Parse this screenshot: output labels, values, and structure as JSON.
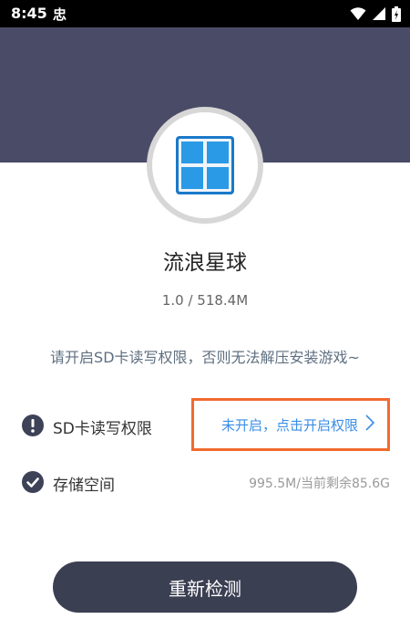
{
  "status_bar": {
    "time": "8:45",
    "notification": "忠"
  },
  "app": {
    "name": "流浪星球",
    "version_size": "1.0 / 518.4M",
    "icon": "window-grid-icon"
  },
  "notice": "请开启SD卡读写权限，否则无法解压安装游戏~",
  "permissions": {
    "sd": {
      "title": "SD卡读写权限",
      "status_link": "未开启，点击开启权限",
      "icon": "exclamation-circle-icon"
    },
    "storage": {
      "title": "存储空间",
      "value": "995.5M/当前剩余85.6G",
      "icon": "check-circle-icon"
    }
  },
  "recheck_button": "重新检测",
  "colors": {
    "header": "#4a4b66",
    "accent_link": "#3a8de6",
    "highlight_box": "#f26a2f",
    "button": "#3b3f52"
  }
}
